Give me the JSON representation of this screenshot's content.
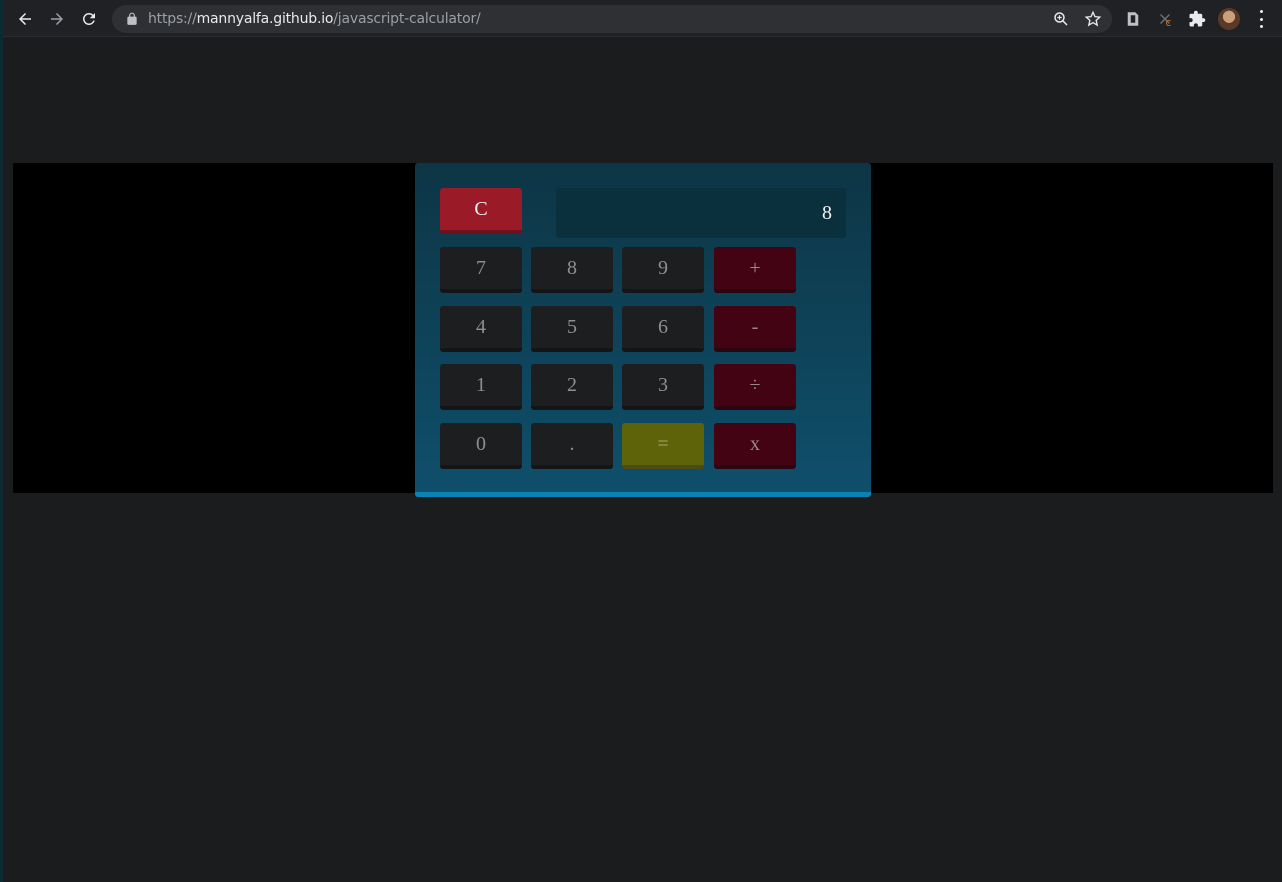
{
  "browser": {
    "url_scheme": "https://",
    "url_host": "mannyalfa.github.io",
    "url_path": "/javascript-calculator/",
    "icons": [
      "back-icon",
      "forward-icon",
      "reload-icon",
      "lock-icon",
      "zoom-icon",
      "star-icon",
      "extension-icon",
      "puzzle-icon",
      "profile-avatar",
      "menu-icon"
    ]
  },
  "calculator": {
    "display_value": "8",
    "clear_label": "C",
    "keys": {
      "k7": "7",
      "k8": "8",
      "k9": "9",
      "plus": "+",
      "k4": "4",
      "k5": "5",
      "k6": "6",
      "minus": "-",
      "k1": "1",
      "k2": "2",
      "k3": "3",
      "divide": "÷",
      "k0": "0",
      "decimal": ".",
      "equals": "=",
      "multiply": "x"
    }
  },
  "colors": {
    "page_bg": "#1b1c1e",
    "band_bg": "#000000",
    "calc_bg_top": "#0d3545",
    "calc_bg_bottom": "#0f4f6b",
    "calc_accent": "#0c82b4",
    "key_number": "#1d1e20",
    "key_operator": "#430312",
    "key_clear": "#9a1a27",
    "key_equals": "#5e6208"
  }
}
